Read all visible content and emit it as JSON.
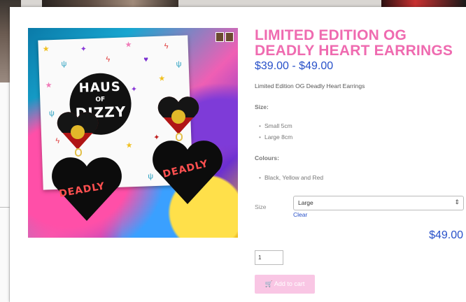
{
  "product": {
    "title": "LIMITED EDITION OG DEADLY HEART EARRINGS",
    "price_min": "$39.00",
    "price_sep": "-",
    "price_max": "$49.00",
    "description": "Limited Edition OG Deadly Heart Earrings",
    "size_heading": "Size:",
    "sizes": [
      "Small 5cm",
      "Large 8cm"
    ],
    "colours_heading": "Colours:",
    "colours": [
      "Black, Yellow and Red"
    ]
  },
  "variation": {
    "size_label": "Size",
    "selected": "Large",
    "clear_label": "Clear",
    "selected_price": "$49.00"
  },
  "cart": {
    "quantity": "1",
    "add_label": "Add to cart",
    "cart_icon": "cart-icon"
  },
  "image": {
    "logo_line1": "HAUS",
    "logo_line2": "OF",
    "logo_line3": "DIZZY",
    "earring_text": "DEADLY"
  },
  "colors": {
    "title": "#ef6bb0",
    "price": "#2750c9",
    "button": "#f9c6e4"
  }
}
